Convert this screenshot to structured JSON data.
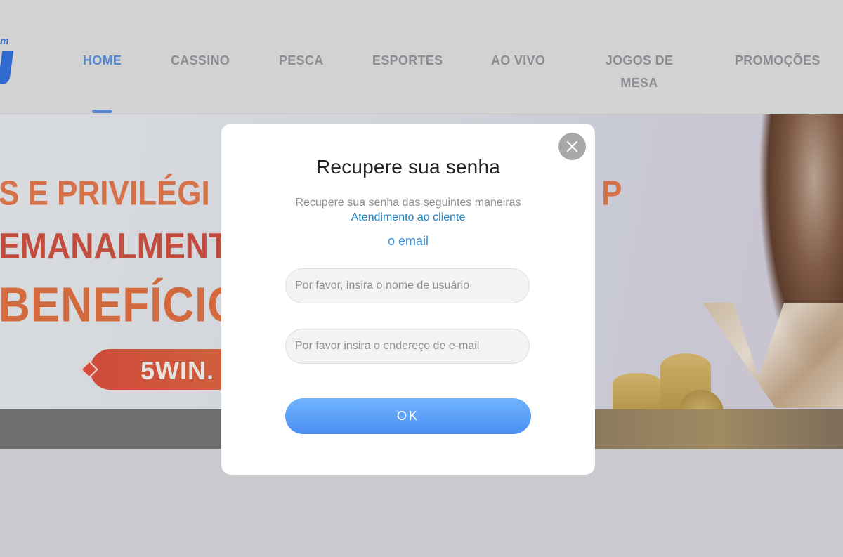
{
  "nav": {
    "items": [
      {
        "label": "HOME",
        "active": true
      },
      {
        "label": "CASSINO"
      },
      {
        "label": "PESCA"
      },
      {
        "label": "ESPORTES"
      },
      {
        "label": "AO VIVO"
      },
      {
        "label": "JOGOS DE MESA"
      },
      {
        "label": "PROMOÇÕES"
      }
    ]
  },
  "logo": {
    "text": "m"
  },
  "banner": {
    "line1": "S E PRIVILÉGI",
    "line1_right": "P",
    "line2": "EMANALMENTE,",
    "line3": "BENEFÍCIO",
    "pill_text": "5WIN."
  },
  "modal": {
    "title": "Recupere sua senha",
    "desc_prefix": "Recupere sua senha das seguintes maneiras",
    "desc_link": "Atendimento ao cliente",
    "email_link": "o email",
    "username_placeholder": "Por favor, insira o nome de usuário",
    "email_placeholder": "Por favor insira o endereço de e-mail",
    "ok_label": "OK",
    "close_icon": "close-icon"
  },
  "colors": {
    "accent_blue": "#3d8fd6",
    "ok_button": "#5b9ef7",
    "nav_active": "#5588d0"
  }
}
